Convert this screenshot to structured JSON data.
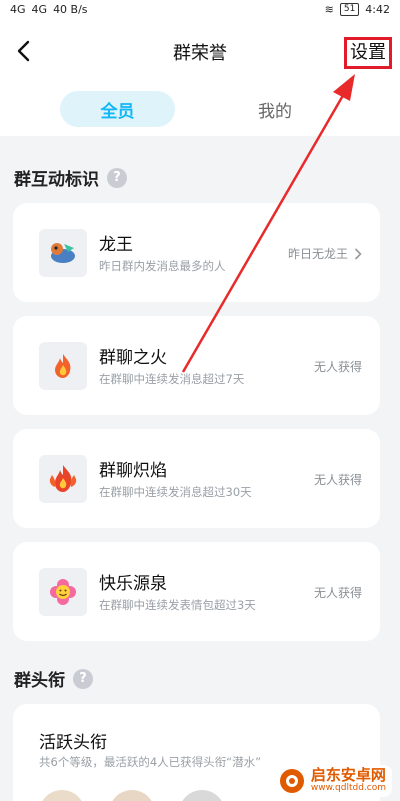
{
  "status_bar": {
    "left_items": [
      "4G",
      "4G",
      "40 B/s"
    ],
    "battery": "51",
    "time": "4:42"
  },
  "header": {
    "title": "群荣誉",
    "settings_label": "设置"
  },
  "tabs": [
    {
      "label": "全员",
      "active": true
    },
    {
      "label": "我的",
      "active": false
    }
  ],
  "section_interaction": {
    "title": "群互动标识",
    "items": [
      {
        "title": "龙王",
        "desc": "昨日群内发消息最多的人",
        "status": "昨日无龙王",
        "icon": "dragon-icon"
      },
      {
        "title": "群聊之火",
        "desc": "在群聊中连续发消息超过7天",
        "status": "无人获得",
        "icon": "fire-icon"
      },
      {
        "title": "群聊炽焰",
        "desc": "在群聊中连续发消息超过30天",
        "status": "无人获得",
        "icon": "blaze-icon"
      },
      {
        "title": "快乐源泉",
        "desc": "在群聊中连续发表情包超过3天",
        "status": "无人获得",
        "icon": "happy-flower-icon"
      }
    ]
  },
  "section_titles": {
    "title": "群头衔",
    "active_title": {
      "title": "活跃头衔",
      "desc": "共6个等级，最活跃的4人已获得头衔“潜水”"
    }
  },
  "watermark": {
    "name": "启东安卓网",
    "url": "www.qdltdd.com"
  },
  "colors": {
    "accent": "#12b7f5",
    "highlight_box": "#e21b2a",
    "arrow": "#e82a2a"
  }
}
